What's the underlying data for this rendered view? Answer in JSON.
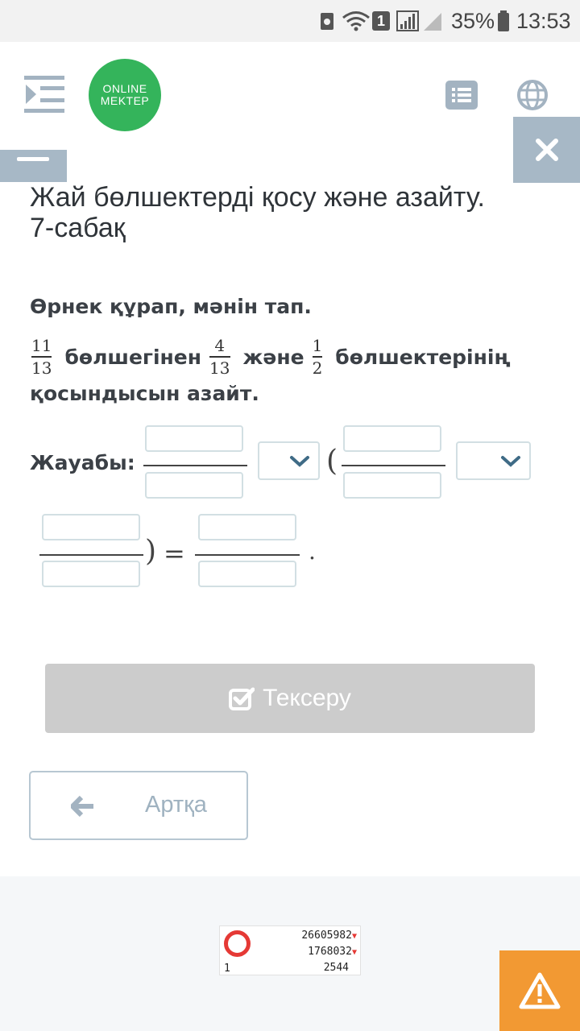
{
  "status_bar": {
    "notification_badge": "1",
    "battery_percent": "35%",
    "time": "13:53"
  },
  "header": {
    "logo_line1": "ONLINE",
    "logo_line2": "MEKTEP",
    "colors": {
      "logo_green": "#34b45b",
      "accent_gray": "#a7b8c6"
    }
  },
  "lesson": {
    "title_line1": "Жай бөлшектерді қосу және азайту.",
    "title_line2": "7-сабақ"
  },
  "task": {
    "heading": "Өрнек құрап, мәнін тап.",
    "frac1": {
      "num": "11",
      "den": "13"
    },
    "word1": "бөлшегінен",
    "frac2": {
      "num": "4",
      "den": "13"
    },
    "word2": "және",
    "frac3": {
      "num": "1",
      "den": "2"
    },
    "word3": "бөлшектерінің",
    "line2": "қосындысын азайт."
  },
  "answer": {
    "label": "Жауабы:",
    "open_paren": "(",
    "close_paren": ")",
    "equals": "=",
    "period": "."
  },
  "buttons": {
    "check_label": "Тексеру",
    "back_label": "Артқа"
  },
  "widget": {
    "left_number": "1",
    "line1": "26605982",
    "line2": "1768032",
    "line3": "2544"
  }
}
